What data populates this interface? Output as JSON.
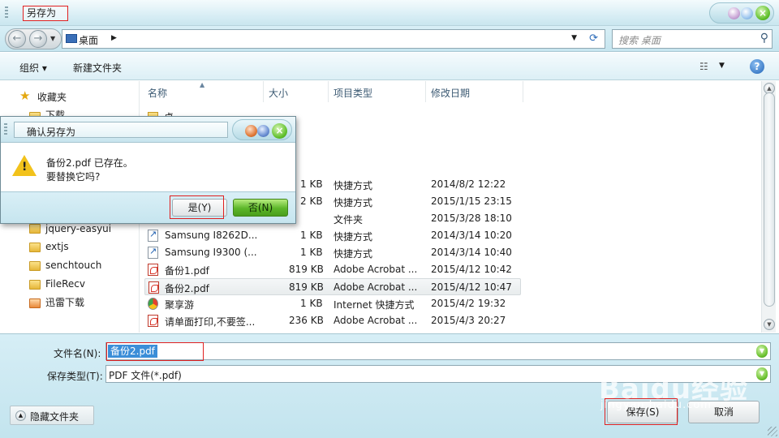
{
  "window": {
    "title": "另存为"
  },
  "address": {
    "location": "桌面",
    "search_placeholder": "搜索 桌面"
  },
  "toolbar": {
    "organize": "组织 ▾",
    "new_folder": "新建文件夹"
  },
  "sidebar": {
    "favorites": "收藏夹",
    "items": [
      {
        "label": "下载"
      },
      {
        "label": "jquery-easyui"
      },
      {
        "label": "extjs"
      },
      {
        "label": "senchtouch"
      },
      {
        "label": "FileRecv"
      },
      {
        "label": "迅雷下载"
      }
    ]
  },
  "file_list": {
    "columns": [
      "名称",
      "大小",
      "项目类型",
      "修改日期"
    ],
    "rows": [
      {
        "name": "桌",
        "size": "",
        "type": "",
        "date": "",
        "icon": "folder-icon"
      },
      {
        "name": "",
        "size": "1 KB",
        "type": "快捷方式",
        "date": "2014/8/2 12:22",
        "icon": "shortcut-icon"
      },
      {
        "name": "",
        "size": "2 KB",
        "type": "快捷方式",
        "date": "2015/1/15 23:15",
        "icon": "shortcut-icon"
      },
      {
        "name": "",
        "size": "",
        "type": "文件夹",
        "date": "2015/3/28 18:10",
        "icon": "folder-icon"
      },
      {
        "name": "Samsung I8262D...",
        "size": "1 KB",
        "type": "快捷方式",
        "date": "2014/3/14 10:20",
        "icon": "shortcut-icon"
      },
      {
        "name": "Samsung I9300 (...",
        "size": "1 KB",
        "type": "快捷方式",
        "date": "2014/3/14 10:40",
        "icon": "shortcut-icon"
      },
      {
        "name": "备份1.pdf",
        "size": "819 KB",
        "type": "Adobe Acrobat ...",
        "date": "2015/4/12 10:42",
        "icon": "pdf-icon"
      },
      {
        "name": "备份2.pdf",
        "size": "819 KB",
        "type": "Adobe Acrobat ...",
        "date": "2015/4/12 10:47",
        "icon": "pdf-icon"
      },
      {
        "name": "聚享游",
        "size": "1 KB",
        "type": "Internet 快捷方式",
        "date": "2015/4/2 19:32",
        "icon": "internet-shortcut-icon"
      },
      {
        "name": "请单面打印,不要签...",
        "size": "236 KB",
        "type": "Adobe Acrobat ...",
        "date": "2015/4/3 20:27",
        "icon": "pdf-icon"
      }
    ]
  },
  "form": {
    "filename_label": "文件名(N):",
    "filename_value": "备份2.pdf",
    "filetype_label": "保存类型(T):",
    "filetype_value": "PDF 文件(*.pdf)",
    "hide_folders": "隐藏文件夹",
    "save": "保存(S)",
    "cancel": "取消"
  },
  "confirm_dialog": {
    "title": "确认另存为",
    "message_line1": "备份2.pdf 已存在。",
    "message_line2": "要替换它吗?",
    "yes": "是(Y)",
    "no": "否(N)"
  },
  "watermark": {
    "text": "Baidu经验",
    "sub": "jingyan.baidu.com"
  }
}
